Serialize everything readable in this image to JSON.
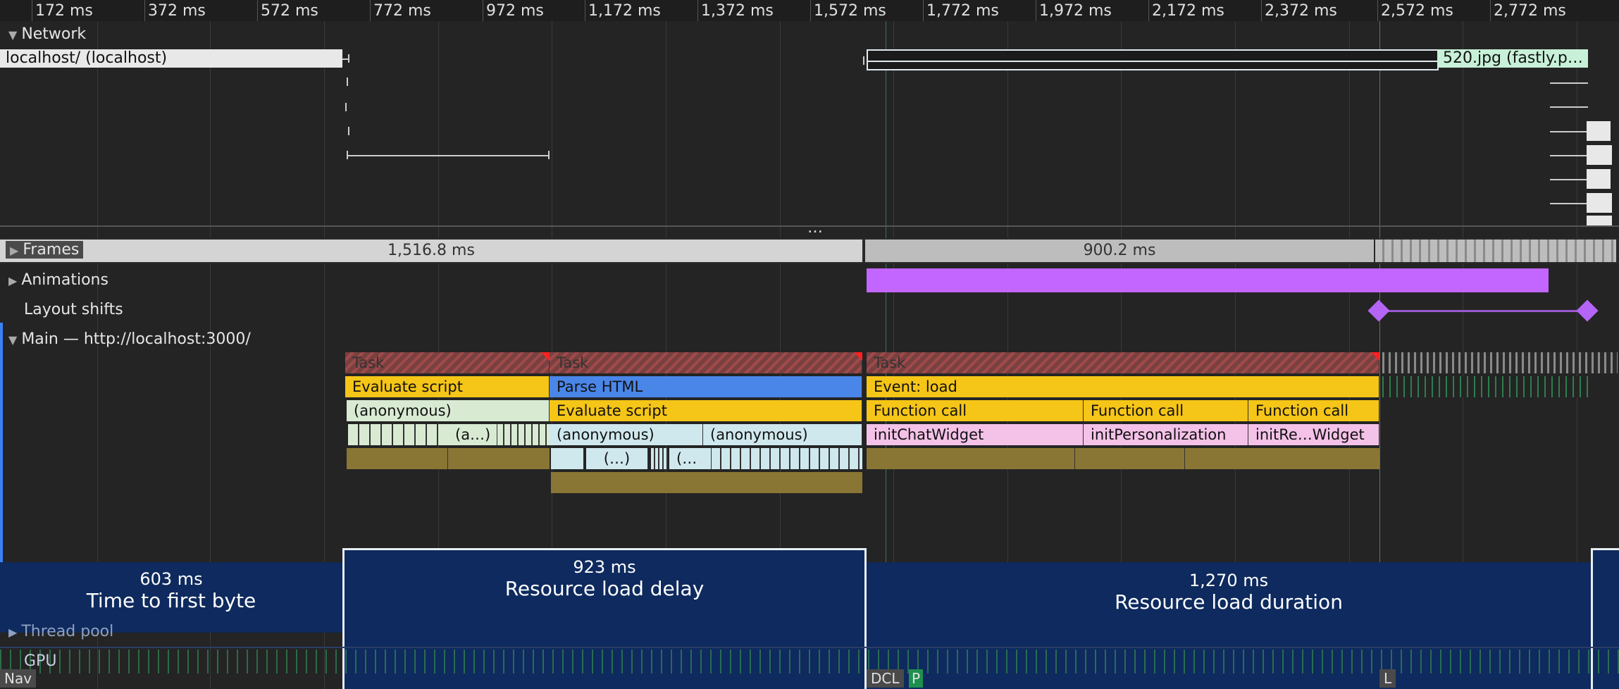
{
  "ruler": {
    "ticks": [
      "172 ms",
      "372 ms",
      "572 ms",
      "772 ms",
      "972 ms",
      "1,172 ms",
      "1,372 ms",
      "1,572 ms",
      "1,772 ms",
      "1,972 ms",
      "2,172 ms",
      "2,372 ms",
      "2,572 ms",
      "2,772 ms"
    ]
  },
  "tracks": {
    "network": "Network",
    "frames": "Frames",
    "animations": "Animations",
    "layout_shifts": "Layout shifts",
    "main": "Main — http://localhost:3000/",
    "thread_pool": "Thread pool",
    "gpu": "GPU"
  },
  "network": {
    "localhost_request": "localhost/ (localhost)",
    "image_request": "520.jpg (fastly.p…"
  },
  "frames": {
    "first_duration": "1,516.8 ms",
    "second_duration": "900.2 ms"
  },
  "overflow_dots": "…",
  "flame": {
    "task1": "Task",
    "task2": "Task",
    "task3": "Task",
    "evaluate_script_1": "Evaluate script",
    "parse_html": "Parse HTML",
    "event_load": "Event: load",
    "anonymous_1": "(anonymous)",
    "anon_short": "(a…)",
    "evaluate_script_2": "Evaluate script",
    "function_call_1": "Function call",
    "function_call_2": "Function call",
    "function_call_3": "Function call",
    "anonymous_2": "(anonymous)",
    "anonymous_3": "(anonymous)",
    "init_chat": "initChatWidget",
    "init_personalization": "initPersonalization",
    "init_re_widget": "initRe…Widget",
    "paren_1": "(…)",
    "paren_2": "(…"
  },
  "lcp": [
    {
      "ms": "603 ms",
      "label": "Time to first byte"
    },
    {
      "ms": "923 ms",
      "label": "Resource load delay"
    },
    {
      "ms": "1,270 ms",
      "label": "Resource load duration"
    }
  ],
  "markers": {
    "nav": "Nav",
    "dcl": "DCL",
    "p": "P",
    "l": "L"
  },
  "colors": {
    "task_red": "#a04a4a",
    "script_yellow": "#f5c518",
    "parse_blue": "#4a86e8",
    "anon_green": "#d9ead3",
    "anon_blue": "#cfe8ee",
    "init_pink": "#f4c1e8",
    "animation_purple": "#c266ff",
    "lcp_navy": "#0e2a5e"
  }
}
